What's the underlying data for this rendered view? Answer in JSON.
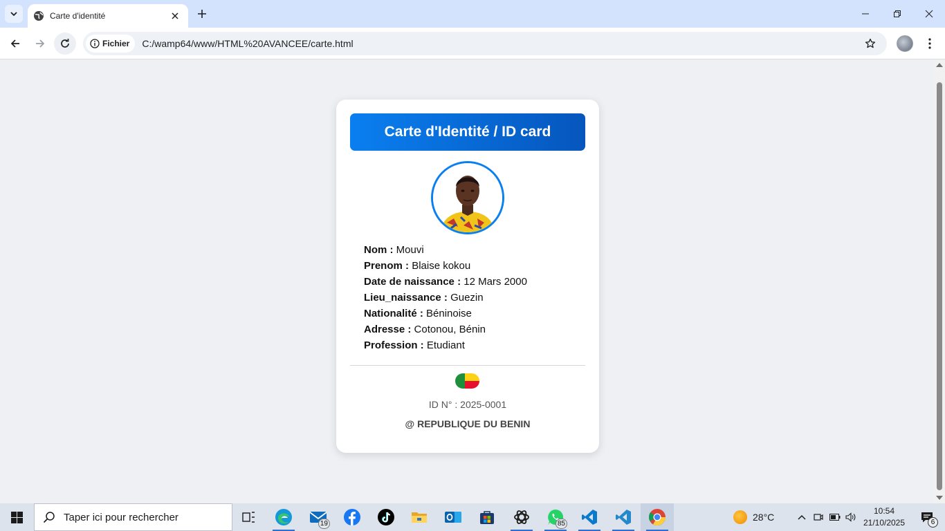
{
  "browser": {
    "tab": {
      "title": "Carte d'identité",
      "favicon": "globe-icon"
    },
    "address": {
      "chip_label": "Fichier",
      "url": "C:/wamp64/www/HTML%20AVANCEE/carte.html"
    }
  },
  "card": {
    "title": "Carte d'Identité / ID card",
    "fields": [
      {
        "label": "Nom :",
        "value": "Mouvi"
      },
      {
        "label": "Prenom :",
        "value": "Blaise kokou"
      },
      {
        "label": "Date de naissance :",
        "value": "12 Mars 2000"
      },
      {
        "label": "Lieu_naissance :",
        "value": "Guezin"
      },
      {
        "label": "Nationalité :",
        "value": "Béninoise"
      },
      {
        "label": "Adresse :",
        "value": "Cotonou, Bénin"
      },
      {
        "label": "Profession :",
        "value": "Etudiant"
      }
    ],
    "id_number": "ID N° : 2025-0001",
    "issuer": "@ REPUBLIQUE DU BENIN",
    "colors": {
      "header_start": "#0a7ff0",
      "header_end": "#0656bd",
      "photo_border": "#0a7ff0"
    },
    "flag_colors": {
      "green": "#1f8f3c",
      "yellow": "#fcd116",
      "red": "#e8112d"
    }
  },
  "taskbar": {
    "search_placeholder": "Taper ici pour rechercher",
    "apps": [
      {
        "name": "task-view-icon"
      },
      {
        "name": "edge-icon"
      },
      {
        "name": "mail-icon",
        "badge": "19"
      },
      {
        "name": "facebook-icon"
      },
      {
        "name": "tiktok-icon"
      },
      {
        "name": "file-explorer-icon"
      },
      {
        "name": "outlook-icon"
      },
      {
        "name": "microsoft-store-icon"
      },
      {
        "name": "chatgpt-icon"
      },
      {
        "name": "whatsapp-icon",
        "badge": "85"
      },
      {
        "name": "vscode-icon"
      },
      {
        "name": "vscode-icon"
      },
      {
        "name": "chrome-icon"
      }
    ],
    "weather": {
      "temp": "28°C"
    },
    "clock": {
      "time": "10:54",
      "date": "21/10/2025"
    },
    "notifications": "6"
  }
}
